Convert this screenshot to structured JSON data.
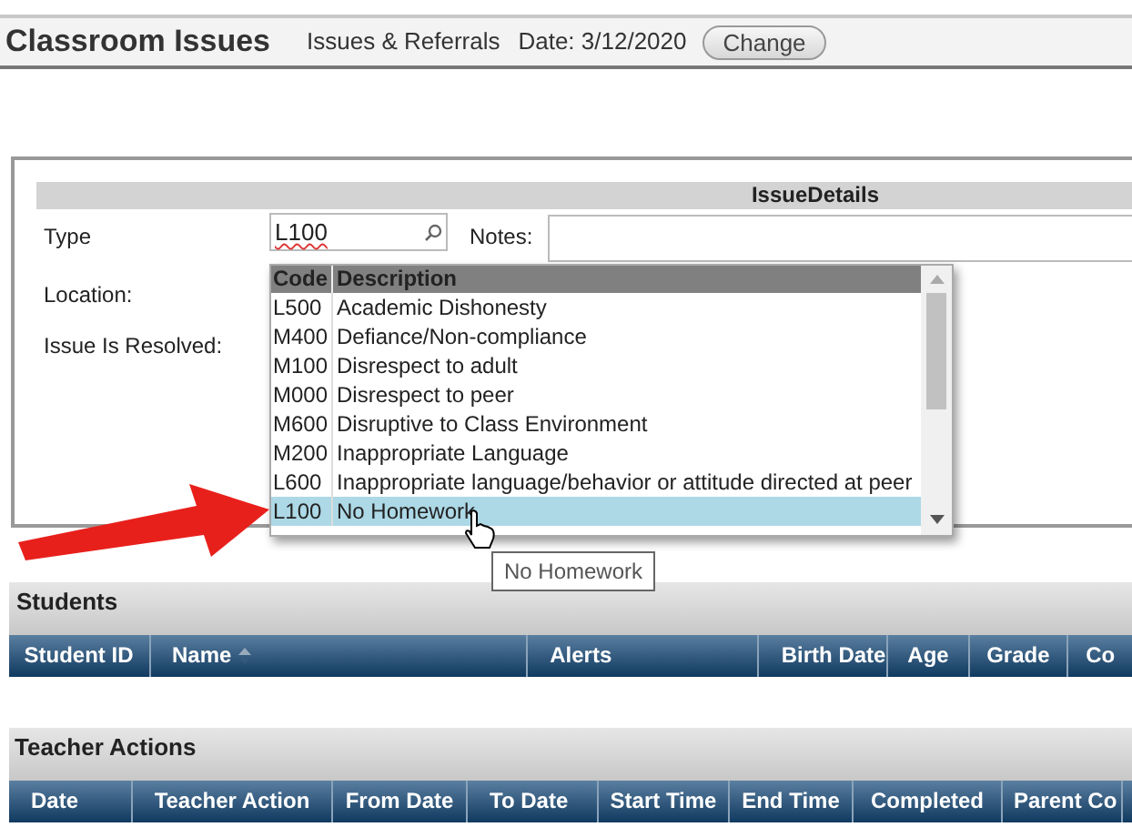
{
  "header": {
    "title": "Classroom Issues",
    "subtitle": "Issues & Referrals",
    "date": "Date: 3/12/2020",
    "change_button": "Change"
  },
  "issue_details": {
    "title": "IssueDetails",
    "type_label": "Type",
    "type_value": "L100",
    "notes_label": "Notes:",
    "location_label": "Location:",
    "resolved_label": "Issue Is Resolved:"
  },
  "dropdown": {
    "columns": [
      "Code",
      "Description"
    ],
    "rows": [
      {
        "code": "L500",
        "description": "Academic Dishonesty",
        "selected": false
      },
      {
        "code": "M400",
        "description": "Defiance/Non-compliance",
        "selected": false
      },
      {
        "code": "M100",
        "description": "Disrespect to adult",
        "selected": false
      },
      {
        "code": "M000",
        "description": "Disrespect to peer",
        "selected": false
      },
      {
        "code": "M600",
        "description": "Disruptive to Class Environment",
        "selected": false
      },
      {
        "code": "M200",
        "description": "Inappropriate Language",
        "selected": false
      },
      {
        "code": "L600",
        "description": "Inappropriate language/behavior or attitude directed at peer",
        "selected": false
      },
      {
        "code": "L100",
        "description": "No Homework",
        "selected": true
      }
    ]
  },
  "tooltip": "No Homework",
  "students": {
    "title": "Students",
    "columns": [
      "Student ID",
      "Name",
      "Alerts",
      "Birth Date",
      "Age",
      "Grade",
      "Co"
    ]
  },
  "teacher_actions": {
    "title": "Teacher Actions",
    "columns": [
      "Date",
      "Teacher Action",
      "From Date",
      "To Date",
      "Start Time",
      "End Time",
      "Completed",
      "Parent Co"
    ]
  }
}
